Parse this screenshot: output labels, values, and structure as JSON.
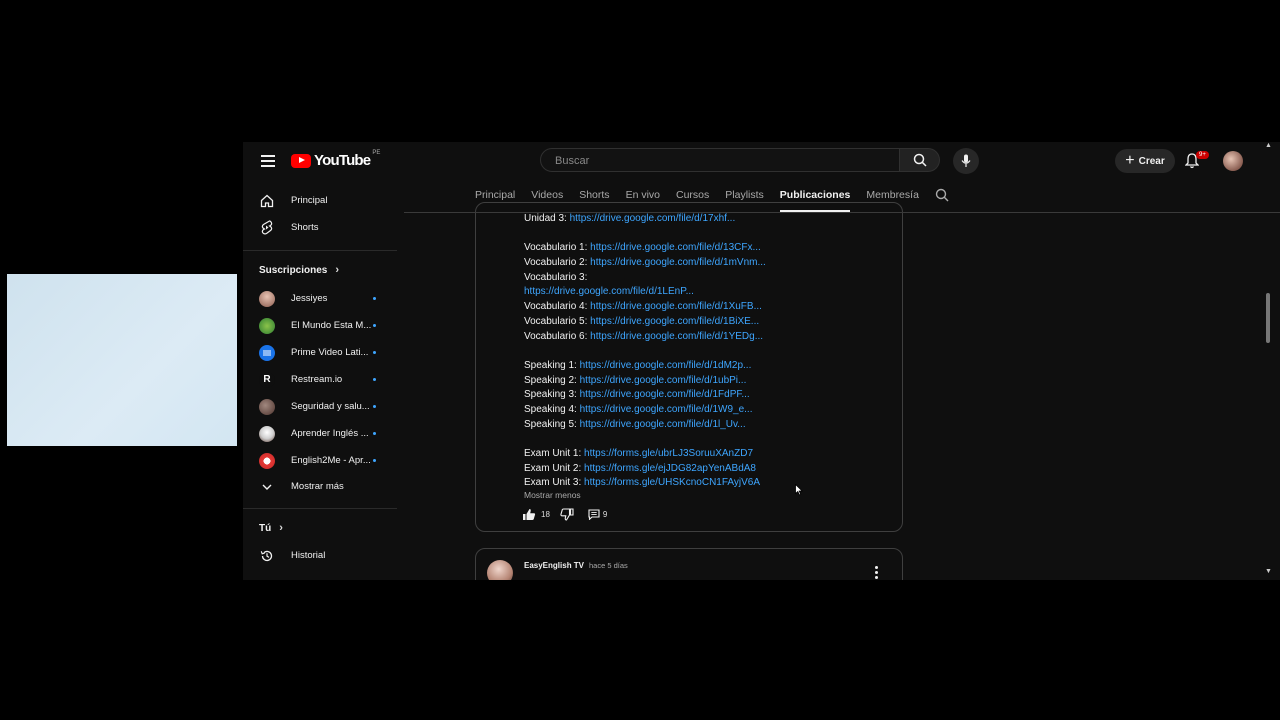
{
  "header": {
    "logo_text": "YouTube",
    "country_code": "PE",
    "search_placeholder": "Buscar",
    "create_label": "Crear",
    "notifications_badge": "9+"
  },
  "sidebar": {
    "main": [
      {
        "label": "Principal",
        "icon": "home-icon"
      },
      {
        "label": "Shorts",
        "icon": "shorts-icon"
      }
    ],
    "subscriptions_heading": "Suscripciones",
    "subscriptions": [
      {
        "label": "Jessiyes",
        "color": "#b88070"
      },
      {
        "label": "El Mundo Esta M...",
        "color": "#4caf50"
      },
      {
        "label": "Prime Video Lati...",
        "color": "#1a73e8"
      },
      {
        "label": "Restream.io",
        "color": "#0f0f0f"
      },
      {
        "label": "Seguridad y salu...",
        "color": "#8d6e63"
      },
      {
        "label": "Aprender Inglés ...",
        "color": "#d9d9d9"
      },
      {
        "label": "English2Me - Apr...",
        "color": "#e53935"
      }
    ],
    "show_more": "Mostrar más",
    "you_heading": "Tú",
    "history": "Historial"
  },
  "tabs": [
    {
      "label": "Principal",
      "active": false
    },
    {
      "label": "Videos",
      "active": false
    },
    {
      "label": "Shorts",
      "active": false
    },
    {
      "label": "En vivo",
      "active": false
    },
    {
      "label": "Cursos",
      "active": false
    },
    {
      "label": "Playlists",
      "active": false
    },
    {
      "label": "Publicaciones",
      "active": true
    },
    {
      "label": "Membresía",
      "active": false
    }
  ],
  "post": {
    "lines": [
      {
        "prefix": "Unidad 3: ",
        "link": "https://drive.google.com/file/d/17xhf..."
      },
      {
        "prefix": "",
        "link": ""
      },
      {
        "prefix": "Vocabulario 1: ",
        "link": "https://drive.google.com/file/d/13CFx..."
      },
      {
        "prefix": "Vocabulario 2: ",
        "link": "https://drive.google.com/file/d/1mVnm..."
      },
      {
        "prefix": "Vocabulario 3:",
        "link": ""
      },
      {
        "prefix": "",
        "link": "https://drive.google.com/file/d/1LEnP..."
      },
      {
        "prefix": "Vocabulario 4: ",
        "link": "https://drive.google.com/file/d/1XuFB..."
      },
      {
        "prefix": "Vocabulario 5: ",
        "link": "https://drive.google.com/file/d/1BiXE..."
      },
      {
        "prefix": "Vocabulario 6: ",
        "link": "https://drive.google.com/file/d/1YEDg..."
      },
      {
        "prefix": "",
        "link": ""
      },
      {
        "prefix": "Speaking 1: ",
        "link": "https://drive.google.com/file/d/1dM2p..."
      },
      {
        "prefix": "Speaking 2: ",
        "link": "https://drive.google.com/file/d/1ubPi..."
      },
      {
        "prefix": "Speaking 3: ",
        "link": "https://drive.google.com/file/d/1FdPF..."
      },
      {
        "prefix": "Speaking 4: ",
        "link": "https://drive.google.com/file/d/1W9_e..."
      },
      {
        "prefix": "Speaking 5: ",
        "link": "https://drive.google.com/file/d/1l_Uv..."
      },
      {
        "prefix": "",
        "link": ""
      },
      {
        "prefix": "Exam Unit 1: ",
        "link": "https://forms.gle/ubrLJ3SoruuXAnZD7"
      },
      {
        "prefix": "Exam Unit 2: ",
        "link": "https://forms.gle/ejJDG82apYenABdA8"
      },
      {
        "prefix": "Exam Unit 3: ",
        "link": "https://forms.gle/UHSKcnoCN1FAyjV6A"
      }
    ],
    "show_less": "Mostrar menos",
    "likes": "18",
    "comments": "9"
  },
  "next_post": {
    "author": "EasyEnglish TV",
    "time": "hace 5 días"
  }
}
